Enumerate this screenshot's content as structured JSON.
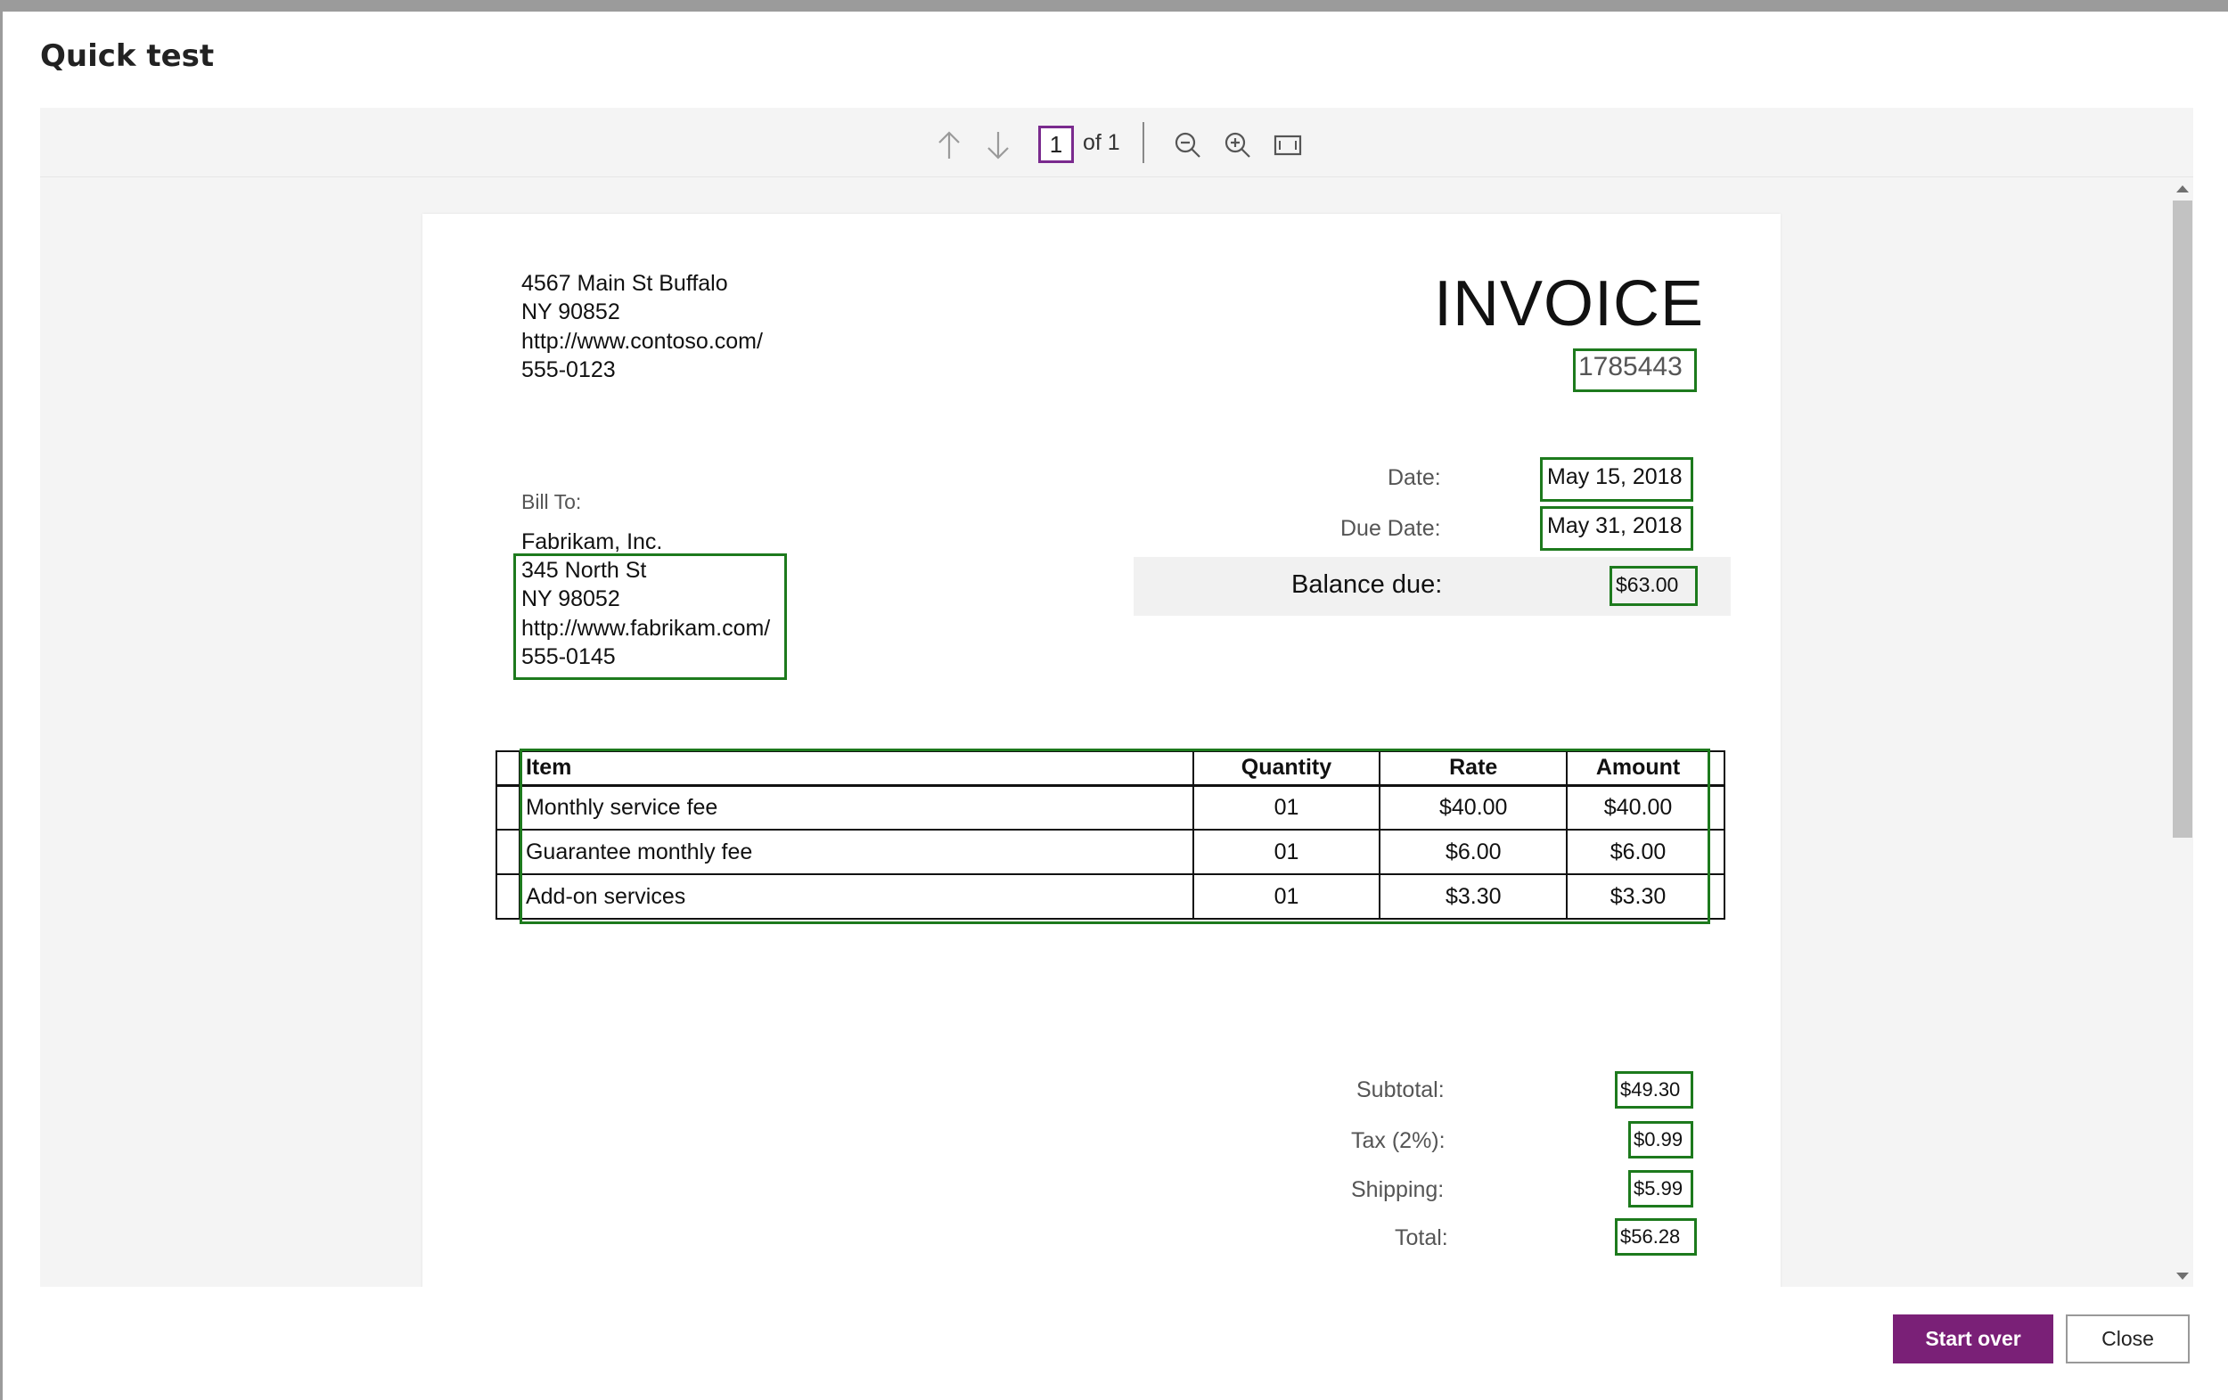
{
  "dialog": {
    "title": "Quick test"
  },
  "toolbar": {
    "prev_icon": "arrow-up-icon",
    "next_icon": "arrow-down-icon",
    "page_value": "1",
    "page_of": "of 1",
    "zoom_out_icon": "zoom-out-icon",
    "zoom_in_icon": "zoom-in-icon",
    "fit_icon": "fit-page-icon"
  },
  "invoice": {
    "sender_address": [
      "4567 Main St Buffalo",
      "NY 90852",
      "http://www.contoso.com/",
      "555-0123"
    ],
    "title": "INVOICE",
    "number": "1785443",
    "bill_to_label": "Bill To:",
    "bill_to_company": "Fabrikam, Inc.",
    "bill_to_address": [
      "345 North St",
      "NY 98052",
      "http://www.fabrikam.com/",
      "555-0145"
    ],
    "date_label": "Date:",
    "date_value": "May 15, 2018",
    "due_date_label": "Due Date:",
    "due_date_value": "May 31, 2018",
    "balance_label": "Balance due:",
    "balance_value": "$63.00",
    "table": {
      "headers": [
        "Item",
        "Quantity",
        "Rate",
        "Amount"
      ],
      "rows": [
        [
          "Monthly service fee",
          "01",
          "$40.00",
          "$40.00"
        ],
        [
          "Guarantee monthly fee",
          "01",
          "$6.00",
          "$6.00"
        ],
        [
          "Add-on services",
          "01",
          "$3.30",
          "$3.30"
        ]
      ]
    },
    "subtotal_label": "Subtotal:",
    "subtotal_value": "$49.30",
    "tax_label": "Tax (2%):",
    "tax_value": "$0.99",
    "shipping_label": "Shipping:",
    "shipping_value": "$5.99",
    "total_label": "Total:",
    "total_value": "$56.28"
  },
  "footer": {
    "start_over_label": "Start over",
    "close_label": "Close"
  },
  "colors": {
    "accent": "#7a2077",
    "highlight_box": "#1d7a1d",
    "page_input_border": "#7a2a8e"
  }
}
